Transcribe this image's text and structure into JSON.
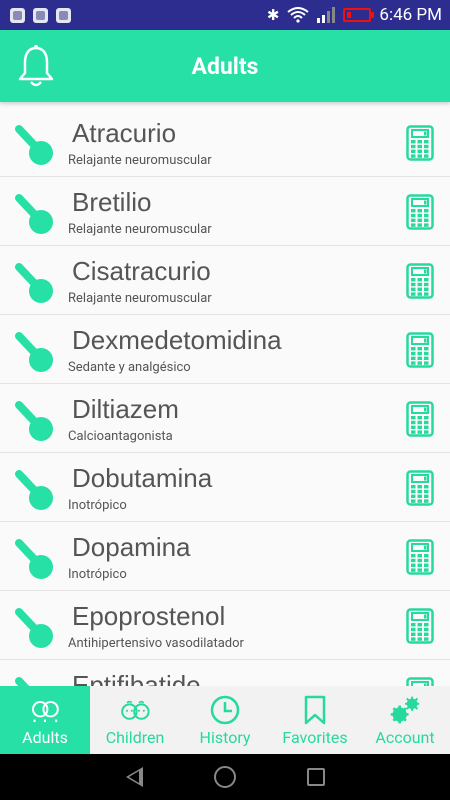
{
  "status": {
    "time": "6:46 PM"
  },
  "header": {
    "title": "Adults"
  },
  "drugs": [
    {
      "name": "Atracurio",
      "class": "Relajante neuromuscular"
    },
    {
      "name": "Bretilio",
      "class": "Relajante neuromuscular"
    },
    {
      "name": "Cisatracurio",
      "class": "Relajante neuromuscular"
    },
    {
      "name": "Dexmedetomidina",
      "class": "Sedante y analgésico"
    },
    {
      "name": "Diltiazem",
      "class": "Calcioantagonista"
    },
    {
      "name": "Dobutamina",
      "class": "Inotrópico"
    },
    {
      "name": "Dopamina",
      "class": "Inotrópico"
    },
    {
      "name": "Epoprostenol",
      "class": "Antihipertensivo vasodilatador"
    },
    {
      "name": "Eptifibatide",
      "class": ""
    }
  ],
  "tabs": [
    {
      "label": "Adults",
      "icon": "adults-icon",
      "active": true
    },
    {
      "label": "Children",
      "icon": "children-icon",
      "active": false
    },
    {
      "label": "History",
      "icon": "clock-icon",
      "active": false
    },
    {
      "label": "Favorites",
      "icon": "bookmark-icon",
      "active": false
    },
    {
      "label": "Account",
      "icon": "gears-icon",
      "active": false
    }
  ],
  "colors": {
    "accent": "#26e0a5",
    "status_bar": "#2d2d8f"
  }
}
